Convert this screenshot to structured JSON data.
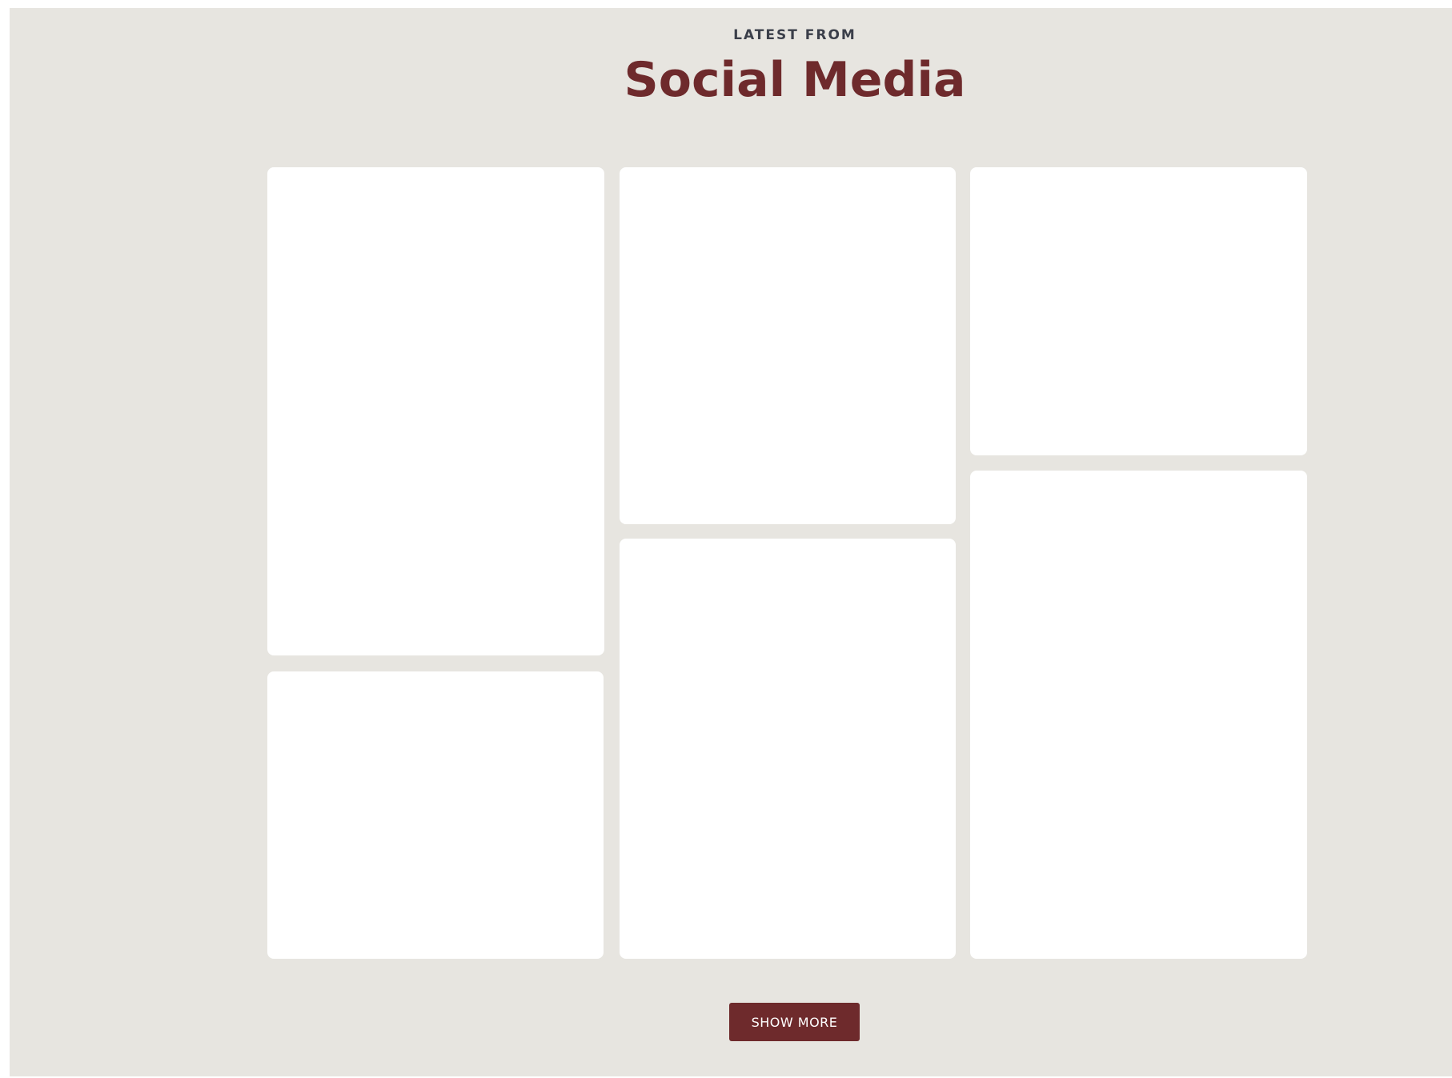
{
  "header": {
    "eyebrow": "LATEST FROM",
    "title": "Social Media"
  },
  "feed": {
    "posts": [
      {
        "column": 1,
        "position": 1
      },
      {
        "column": 1,
        "position": 2
      },
      {
        "column": 2,
        "position": 1
      },
      {
        "column": 2,
        "position": 2
      },
      {
        "column": 3,
        "position": 1
      },
      {
        "column": 3,
        "position": 2
      }
    ]
  },
  "actions": {
    "show_more_label": "SHOW MORE"
  },
  "colors": {
    "background": "#e7e5e0",
    "accent": "#6e2a2c",
    "card": "#ffffff",
    "eyebrow_text": "#3b3f4a"
  }
}
